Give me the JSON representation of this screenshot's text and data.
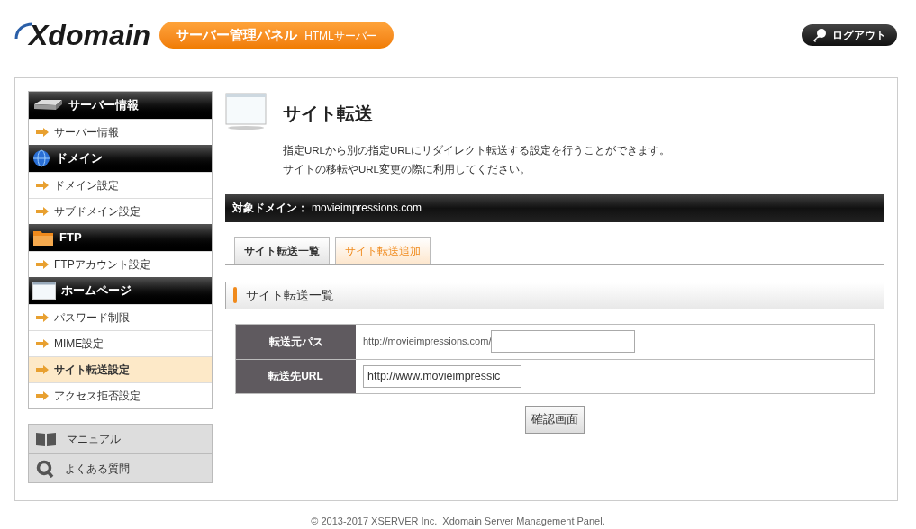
{
  "header": {
    "logo": "Xdomain",
    "badge": {
      "title": "サーバー管理パネル",
      "subtitle": "HTMLサーバー"
    },
    "logout": "ログアウト"
  },
  "sidebar": {
    "sections": [
      {
        "title": "サーバー情報",
        "kind": "server",
        "items": [
          {
            "label": "サーバー情報",
            "selected": false
          }
        ]
      },
      {
        "title": "ドメイン",
        "kind": "globe",
        "items": [
          {
            "label": "ドメイン設定",
            "selected": false
          },
          {
            "label": "サブドメイン設定",
            "selected": false
          }
        ]
      },
      {
        "title": "FTP",
        "kind": "folder",
        "items": [
          {
            "label": "FTPアカウント設定",
            "selected": false
          }
        ]
      },
      {
        "title": "ホームページ",
        "kind": "window",
        "items": [
          {
            "label": "パスワード制限",
            "selected": false
          },
          {
            "label": "MIME設定",
            "selected": false
          },
          {
            "label": "サイト転送設定",
            "selected": true
          },
          {
            "label": "アクセス拒否設定",
            "selected": false
          }
        ]
      }
    ],
    "help_links": [
      {
        "label": "マニュアル",
        "kind": "book"
      },
      {
        "label": "よくある質問",
        "kind": "question"
      }
    ]
  },
  "page": {
    "title": "サイト転送",
    "description": [
      "指定URLから別の指定URLにリダイレクト転送する設定を行うことができます。",
      "サイトの移転やURL変更の際に利用してください。"
    ],
    "domain_bar": {
      "label": "対象ドメイン：",
      "value": "movieimpressions.com"
    },
    "tabs": [
      {
        "label": "サイト転送一覧",
        "selected": false
      },
      {
        "label": "サイト転送追加",
        "selected": true
      }
    ],
    "section_title": "サイト転送一覧",
    "form": {
      "rows": [
        {
          "label": "転送元パス",
          "kind": "prefixed",
          "prefix": "http://movieimpressions.com/"
        },
        {
          "label": "転送先URL",
          "kind": "text",
          "value": "http://www.movieimpressic"
        }
      ],
      "button": "確認画面"
    }
  },
  "footer": "© 2013-2017 XSERVER Inc.  Xdomain Server Management Panel."
}
